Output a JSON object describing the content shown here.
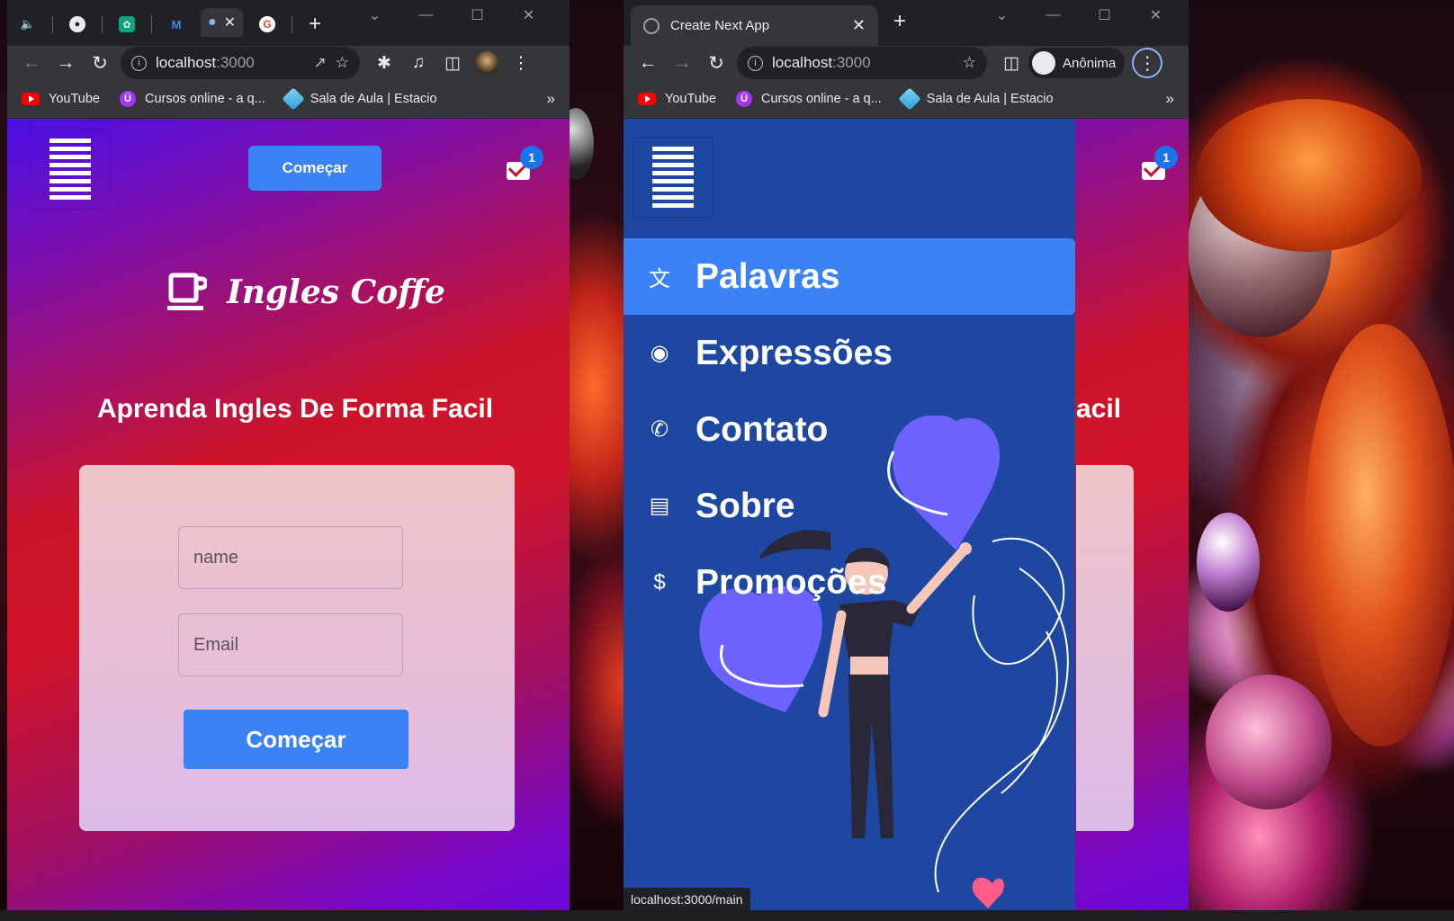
{
  "left_window": {
    "tabs": [
      "",
      "",
      "",
      "",
      ""
    ],
    "url_host": "localhost",
    "url_port": ":3000",
    "bookmarks": [
      "YouTube",
      "Cursos online - a q...",
      "Sala de Aula | Estacio"
    ],
    "bookmarks_more": "»",
    "app": {
      "top_button": "Começar",
      "badge_count": "1",
      "brand_name": "Ingles Coffe",
      "headline": "Aprenda Ingles De Forma Facil",
      "name_placeholder": "name",
      "email_placeholder": "Email",
      "submit_button": "Começar"
    }
  },
  "right_window": {
    "tab_title": "Create Next App",
    "url_host": "localhost",
    "url_port": ":3000",
    "profile_label": "Anônima",
    "bookmarks": [
      "YouTube",
      "Cursos online - a q...",
      "Sala de Aula | Estacio"
    ],
    "bookmarks_more": "»",
    "app": {
      "badge_count": "1",
      "menu": [
        {
          "label": "Palavras",
          "icon": "translate-icon"
        },
        {
          "label": "Expressões",
          "icon": "speaking-person-icon"
        },
        {
          "label": "Contato",
          "icon": "phone-icon"
        },
        {
          "label": "Sobre",
          "icon": "document-icon"
        },
        {
          "label": "Promoções",
          "icon": "dollar-icon"
        }
      ],
      "partial_headline": "acil"
    },
    "status_url": "localhost:3000/main"
  },
  "colors": {
    "primary_button": "#3a82f6",
    "drawer_bg": "#1d47a0",
    "active_menu": "#3b82f6",
    "heart": "#6c63ff"
  }
}
